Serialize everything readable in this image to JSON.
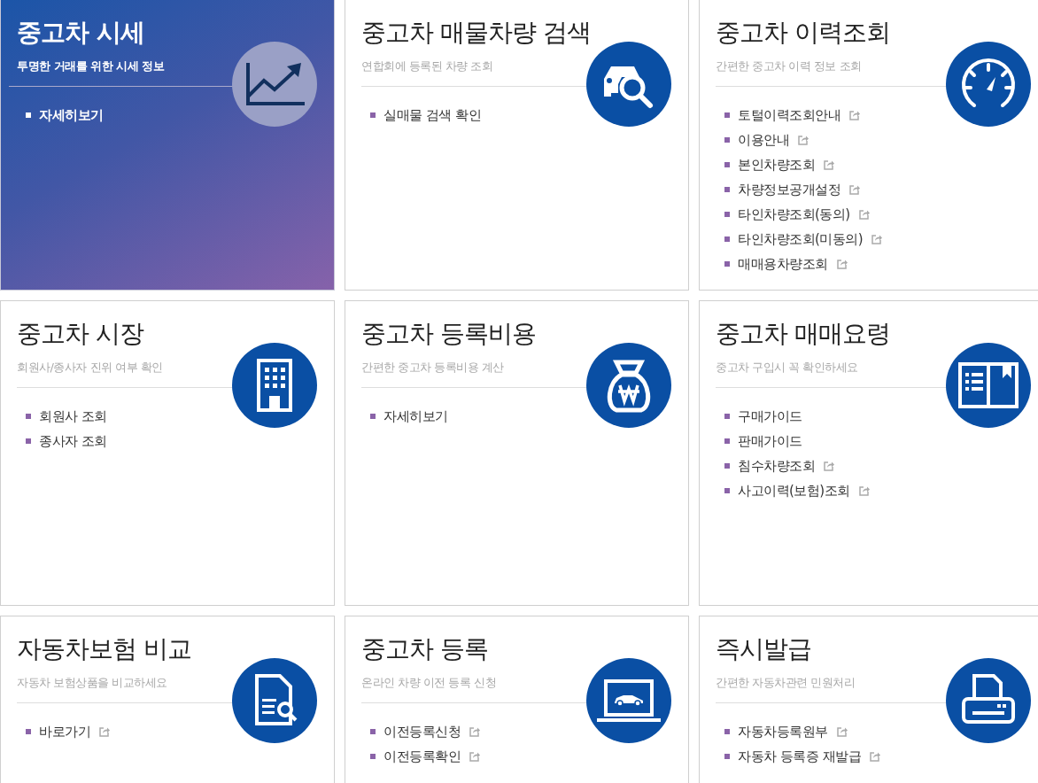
{
  "cards": [
    {
      "title": "중고차 시세",
      "subtitle": "투명한 거래를 위한 시세 정보",
      "featured": true,
      "items": [
        {
          "label": "자세히보기",
          "external": false
        }
      ]
    },
    {
      "title": "중고차 매물차량 검색",
      "subtitle": "연합회에 등록된 차량 조회",
      "featured": false,
      "items": [
        {
          "label": "실매물 검색 확인",
          "external": false
        }
      ]
    },
    {
      "title": "중고차 이력조회",
      "subtitle": "간편한 중고차 이력 정보 조회",
      "featured": false,
      "items": [
        {
          "label": "토털이력조회안내",
          "external": true
        },
        {
          "label": "이용안내",
          "external": true
        },
        {
          "label": "본인차량조회",
          "external": true
        },
        {
          "label": "차량정보공개설정",
          "external": true
        },
        {
          "label": "타인차량조회(동의)",
          "external": true
        },
        {
          "label": "타인차량조회(미동의)",
          "external": true
        },
        {
          "label": "매매용차량조회",
          "external": true
        }
      ]
    },
    {
      "title": "중고차 시장",
      "subtitle": "회원사/종사자 진위 여부 확인",
      "featured": false,
      "items": [
        {
          "label": "회원사 조회",
          "external": false
        },
        {
          "label": "종사자 조회",
          "external": false
        }
      ]
    },
    {
      "title": "중고차 등록비용",
      "subtitle": "간편한 중고차 등록비용 계산",
      "featured": false,
      "items": [
        {
          "label": "자세히보기",
          "external": false
        }
      ]
    },
    {
      "title": "중고차 매매요령",
      "subtitle": "중고차 구입시 꼭 확인하세요",
      "featured": false,
      "items": [
        {
          "label": "구매가이드",
          "external": false
        },
        {
          "label": "판매가이드",
          "external": false
        },
        {
          "label": "침수차량조회",
          "external": true
        },
        {
          "label": "사고이력(보험)조회",
          "external": true
        }
      ]
    },
    {
      "title": "자동차보험 비교",
      "subtitle": "자동차 보험상품을 비교하세요",
      "featured": false,
      "items": [
        {
          "label": "바로가기",
          "external": true
        }
      ]
    },
    {
      "title": "중고차 등록",
      "subtitle": "온라인 차량 이전 등록 신청",
      "featured": false,
      "items": [
        {
          "label": "이전등록신청",
          "external": true
        },
        {
          "label": "이전등록확인",
          "external": true
        }
      ]
    },
    {
      "title": "즉시발급",
      "subtitle": "간편한 자동차관련 민원처리",
      "featured": false,
      "items": [
        {
          "label": "자동차등록원부",
          "external": true
        },
        {
          "label": "자동차 등록증 재발급",
          "external": true
        }
      ]
    }
  ]
}
